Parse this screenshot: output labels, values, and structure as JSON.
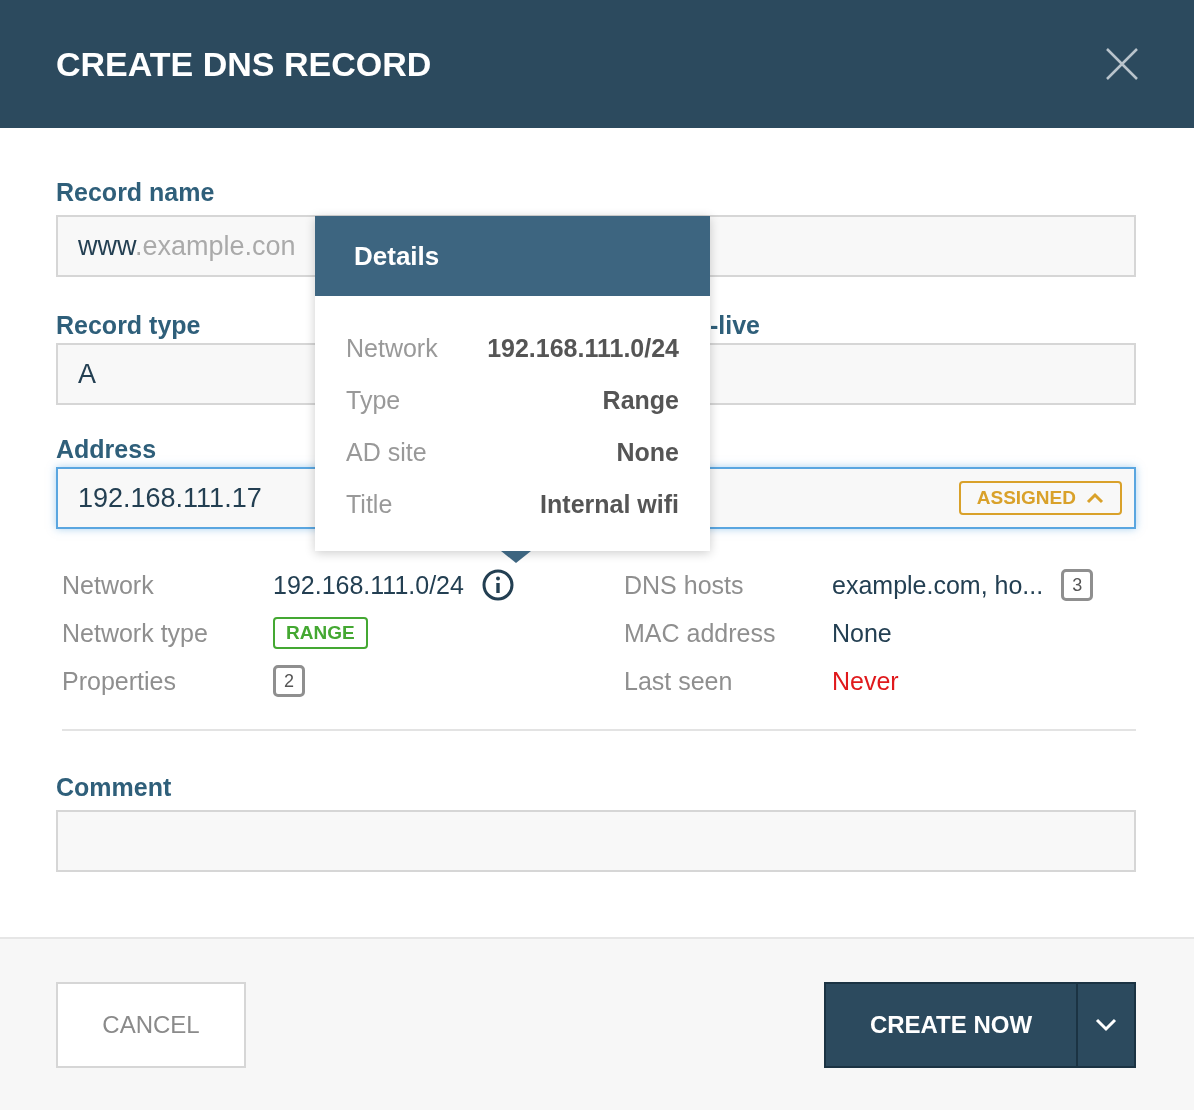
{
  "dialog": {
    "title": "CREATE DNS RECORD"
  },
  "fields": {
    "record_name": {
      "label": "Record name",
      "value": "www",
      "suffix": ".example.con"
    },
    "record_type": {
      "label": "Record type",
      "value": "A"
    },
    "ttl": {
      "label": "-live"
    },
    "address": {
      "label": "Address",
      "value": "192.168.111.17",
      "focused": true,
      "status": "ASSIGNED"
    }
  },
  "popover": {
    "title": "Details",
    "rows": [
      {
        "label": "Network",
        "value": "192.168.111.0/24"
      },
      {
        "label": "Type",
        "value": "Range"
      },
      {
        "label": "AD site",
        "value": "None"
      },
      {
        "label": "Title",
        "value": "Internal wifi"
      }
    ]
  },
  "details": [
    {
      "label": "Network",
      "kind": "text",
      "value": "192.168.111.0/24",
      "info": true
    },
    {
      "label": "DNS hosts",
      "kind": "text",
      "value": "example.com, ho...",
      "count": "3"
    },
    {
      "label": "Network type",
      "kind": "tag",
      "value": "RANGE"
    },
    {
      "label": "MAC address",
      "kind": "text",
      "value": "None"
    },
    {
      "label": "Properties",
      "kind": "count",
      "count": "2"
    },
    {
      "label": "Last seen",
      "kind": "alert",
      "value": "Never"
    }
  ],
  "comment": {
    "label": "Comment"
  },
  "buttons": {
    "cancel": "CANCEL",
    "create": "CREATE NOW"
  }
}
